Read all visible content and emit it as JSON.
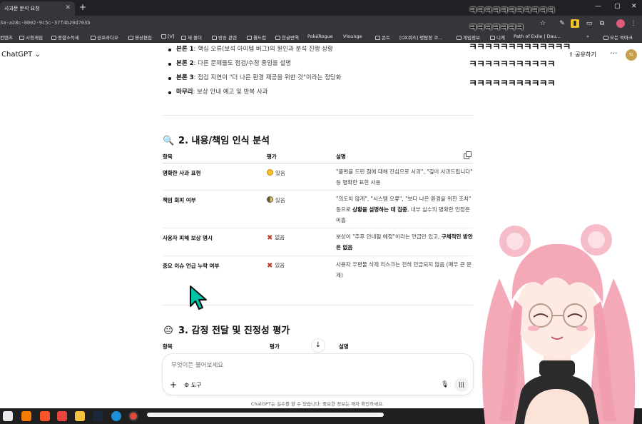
{
  "browser": {
    "tab_title": "사과문 분석 요청",
    "url": "3a-a28c-8002-9c5c-37f4b20d703b",
    "bookmarks": [
      "컨텐츠",
      "시청게임",
      "종합소득세",
      "공포라디오",
      "영상편집",
      "[V]",
      "새 폴더",
      "방송 관련",
      "월드컵",
      "한글번역",
      "PokéRogue",
      "Vlounge",
      "콘트",
      "[OX퀴즈] 명탐정 코...",
      "게임정보",
      "니케",
      "Path of Exile | Dau...",
      "모든 북마크"
    ]
  },
  "app": {
    "title": "ChatGPT",
    "share_label": "공유하기",
    "avatar_initials": "YL"
  },
  "content": {
    "bullets": [
      {
        "bold": "본론 1",
        "text": ": 핵심 오류(보석 아이템 버그)의 원인과 분석 진행 상황"
      },
      {
        "bold": "본론 2",
        "text": ": 다른 문제들도 점검/수정 중임을 설명"
      },
      {
        "bold": "본론 3",
        "text": ": 점검 지연이 \"더 나은 환경 제공을 위한 것\"이라는 정당화"
      },
      {
        "bold": "마무리",
        "text": ": 보상 안내 예고 및 반복 사과"
      }
    ],
    "section2": {
      "icon": "🔍",
      "title": "2. 내용/책임 인식 분석",
      "headers": {
        "item": "항목",
        "eval": "평가",
        "desc": "설명"
      },
      "rows": [
        {
          "item": "명확한 사과 표현",
          "eval_icon": "yes",
          "eval": "있음",
          "desc_1": "\"불편을 드린 점에 대해 진심으로 사과\", \"깊이 사과드립니다\" 등 명확한 표현 사용",
          "desc_bold": "",
          "desc_2": ""
        },
        {
          "item": "책임 회피 여부",
          "eval_icon": "half",
          "eval": "있음",
          "desc_1": "\"의도치 않게\", \"시스템 오류\", \"보다 나은 환경을 위한 조치\" 등으로 ",
          "desc_bold": "상황을 설명하는 데 집중",
          "desc_2": ", 내부 실수의 명확한 인정은 미흡"
        },
        {
          "item": "사용자 피해 보상 명시",
          "eval_icon": "x",
          "eval": "없음",
          "desc_1": "보상이 \"추후 안내될 예정\"이라는 언급만 있고, ",
          "desc_bold": "구체적인 방안은 없음",
          "desc_2": ""
        },
        {
          "item": "중요 이슈 언급 누락 여부",
          "eval_icon": "x",
          "eval": "있음",
          "desc_1": "사용자 우편물 삭제 리스크는 전혀 언급되지 않음 (매우 큰 문제)",
          "desc_bold": "",
          "desc_2": ""
        }
      ]
    },
    "section3": {
      "icon": "😐",
      "title": "3. 감정 전달 및 진정성 평가",
      "headers": {
        "item": "항목",
        "eval": "평가",
        "desc": "설명"
      }
    }
  },
  "composer": {
    "placeholder": "무엇이든 물어보세요",
    "tools_label": "도구"
  },
  "disclaimer": "ChatGPT는 실수를 할 수 있습니다. 중요한 정보는 재차 확인하세요.",
  "overlay_text": [
    "ㅋㅋㅋㅋㅋㅋㅋㅋㅋㅋㅋ",
    "ㅋㅋㅋㅋㅋㅋㅋ",
    "ㅋㅋㅋㅋㅋㅋㅋㅋㅋㅋㅋㅋㅋ",
    "ㅋㅋㅋㅋㅋㅋㅋㅋㅋㅋㅋ",
    "ㅋㅋㅋㅋㅋㅋㅋㅋㅋㅋㅋ"
  ],
  "colors": {
    "cursor": "#00c4a7",
    "avatar": "#c8a24a",
    "hair": "#f4a9b8"
  }
}
